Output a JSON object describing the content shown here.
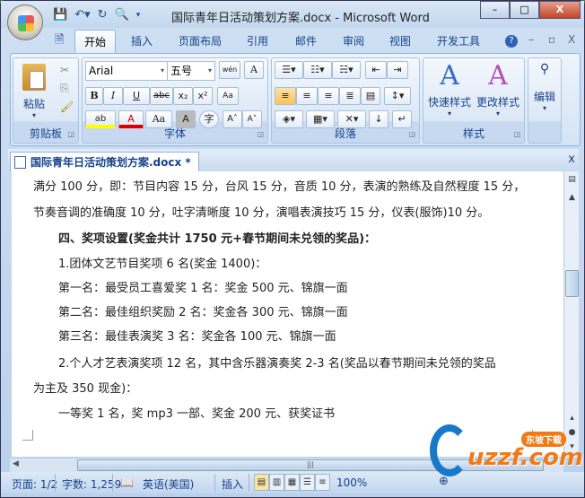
{
  "window": {
    "title": "国际青年日活动策划方案.docx - Microsoft Word",
    "minimize": "–",
    "maximize": "□",
    "close": "X"
  },
  "ribbon_tabs": [
    "开始",
    "插入",
    "页面布局",
    "引用",
    "邮件",
    "审阅",
    "视图",
    "开发工具"
  ],
  "ribbon_controls": {
    "help": "?",
    "min": "–",
    "restore": "▫",
    "close": "X"
  },
  "clipboard": {
    "paste": "粘贴",
    "label": "剪贴板"
  },
  "font": {
    "name": "Arial",
    "size": "五号",
    "label": "字体",
    "bold": "B",
    "italic": "I",
    "underline": "U",
    "strike": "abc",
    "sub": "x₂",
    "sup": "x²",
    "phonetic": "wén",
    "border": "A",
    "highlight": "ab",
    "color": "A",
    "case": "Aa",
    "shade": "A",
    "enclose": "字",
    "grow": "A˄",
    "shrink": "A˅",
    "clear": "Aa"
  },
  "paragraph": {
    "label": "段落"
  },
  "styles": {
    "quick": "快速样式",
    "change": "更改样式",
    "label": "样式"
  },
  "editing": {
    "label": "编辑"
  },
  "doc_tab": {
    "title": "国际青年日活动策划方案.docx *",
    "close": "x"
  },
  "document": {
    "lines": [
      "满分 100 分，即：节目内容 15 分，台风 15 分，音质 10 分，表演的熟练及自然程度 15 分，",
      "节奏音调的准确度 10 分，吐字清晰度 10 分，演唱表演技巧 15 分，仪表(服饰)10 分。",
      "四、奖项设置(奖金共计 1750 元+春节期间未兑领的奖品)：",
      "1.团体文艺节目奖项 6 名(奖金 1400)：",
      "第一名：最受员工喜爱奖 1 名：奖金 500 元、锦旗一面",
      "第二名：最佳组织奖励 2 名：奖金各 300 元、锦旗一面",
      "第三名：最佳表演奖 3 名：奖金各 100 元、锦旗一面",
      "2.个人才艺表演奖项 12 名，其中含乐器演奏奖 2-3 名(奖品以春节期间未兑领的奖品",
      "为主及 350 现金)：",
      "一等奖 1 名，奖 mp3 一部、奖金 200 元、获奖证书"
    ]
  },
  "status": {
    "page": "页面: 1/2",
    "words": "字数: 1,259",
    "language": "英语(美国)",
    "mode": "插入",
    "zoom": "100%"
  },
  "watermark": {
    "text": "uzzf.com",
    "badge": "东坡下载"
  }
}
